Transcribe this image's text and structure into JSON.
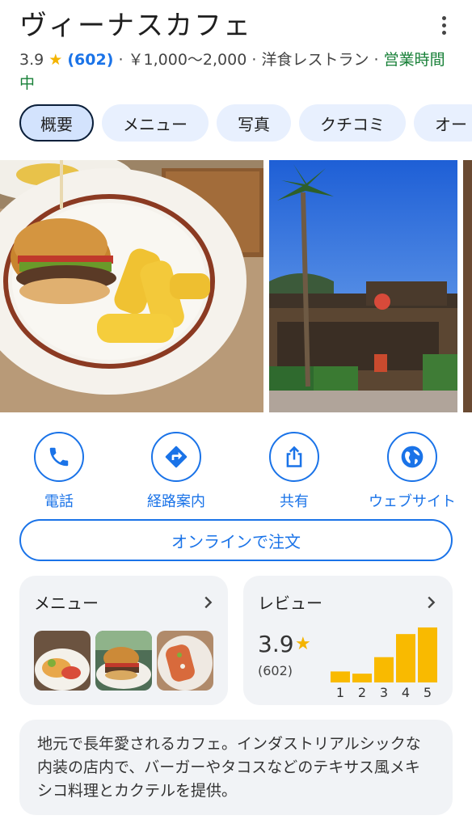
{
  "place": {
    "name": "ヴィーナスカフェ",
    "rating": "3.9",
    "review_count": "(602)",
    "price": "￥1,000〜2,000",
    "category": "洋食レストラン",
    "status": "営業時間中",
    "separator": "·"
  },
  "tabs": [
    {
      "label": "概要",
      "active": true
    },
    {
      "label": "メニュー"
    },
    {
      "label": "写真"
    },
    {
      "label": "クチコミ"
    },
    {
      "label": "オー"
    }
  ],
  "actions": [
    {
      "label": "電話",
      "icon": "phone-icon"
    },
    {
      "label": "経路案内",
      "icon": "directions-icon"
    },
    {
      "label": "共有",
      "icon": "share-icon"
    },
    {
      "label": "ウェブサイト",
      "icon": "globe-icon"
    }
  ],
  "order_button": "オンラインで注文",
  "menu_card": {
    "title": "メニュー"
  },
  "review_card": {
    "title": "レビュー",
    "rating": "3.9",
    "count": "(602)",
    "distribution": [
      {
        "star": "1",
        "share": 0.2
      },
      {
        "star": "2",
        "share": 0.16
      },
      {
        "star": "3",
        "share": 0.46
      },
      {
        "star": "4",
        "share": 0.88
      },
      {
        "star": "5",
        "share": 1.0
      }
    ]
  },
  "description": "地元で長年愛されるカフェ。インダストリアルシックな内装の店内で、バーガーやタコスなどのテキサス風メキシコ料理とカクテルを提供。",
  "colors": {
    "accent": "#1a73e8",
    "star": "#f4b400",
    "open": "#188038",
    "bar": "#f9ba00"
  }
}
